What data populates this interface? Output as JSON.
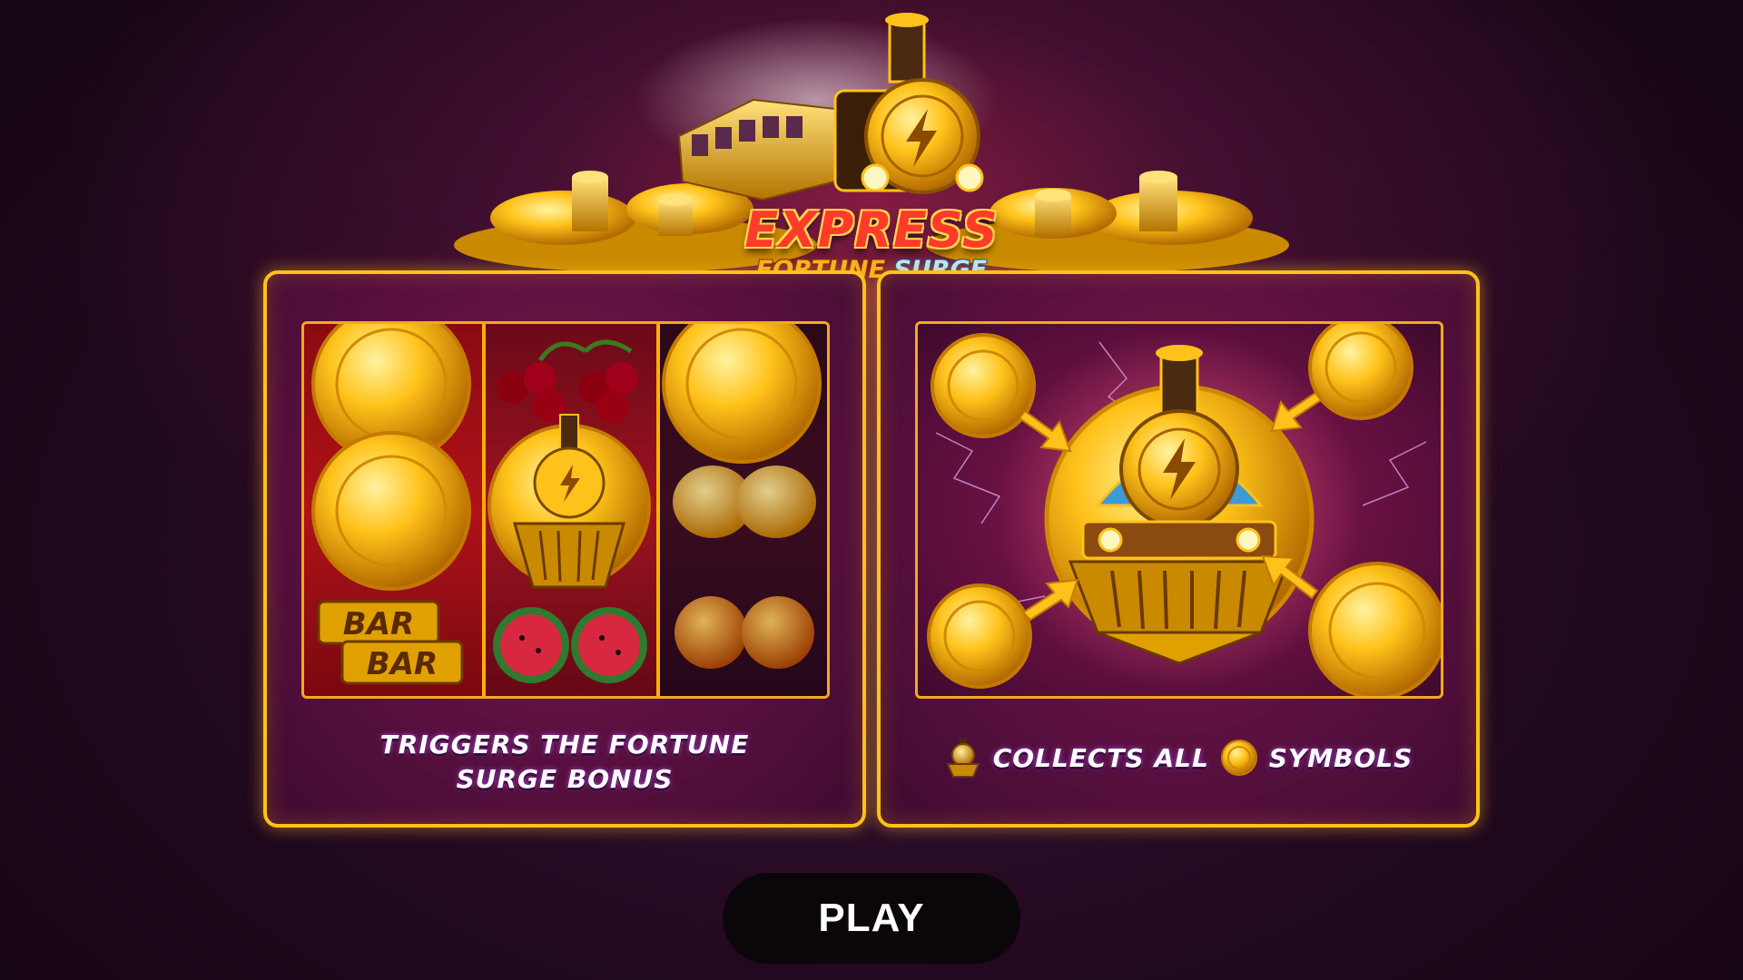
{
  "game": {
    "logo_title": "EXPRESS",
    "logo_subtitle_part1": "FORTUNE",
    "logo_subtitle_part2": "SURGE"
  },
  "left_panel": {
    "reels": [
      [
        "coin",
        "coin",
        "bar-bar"
      ],
      [
        "cherries",
        "train-coin",
        "watermelon"
      ],
      [
        "coin",
        "lemon",
        "orange"
      ]
    ],
    "bar_text_1": "BAR",
    "bar_text_2": "BAR",
    "caption_line1": "TRIGGERS THE FORTUNE",
    "caption_line2": "SURGE BONUS"
  },
  "right_panel": {
    "caption_part1": "COLLECTS ALL",
    "caption_part2": "SYMBOLS",
    "icons": [
      "train-icon",
      "coin-icon"
    ]
  },
  "play_button": {
    "label": "PLAY"
  },
  "colors": {
    "panel_border": "#ffc21a",
    "panel_bg": "#5a1040",
    "background": "#22091f",
    "play_bg": "#0b0609"
  }
}
